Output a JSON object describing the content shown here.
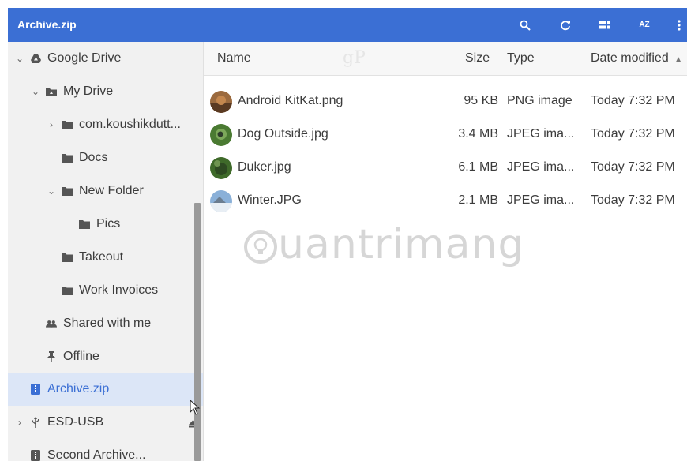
{
  "window": {
    "title": "Archive.zip"
  },
  "toolbar": {
    "icons": [
      "search-icon",
      "refresh-icon",
      "grid-view-icon",
      "sort-az-icon",
      "more-vert-icon"
    ],
    "sort_label": "AZ"
  },
  "sidebar": {
    "items": [
      {
        "label": "Google Drive",
        "icon": "drive-icon",
        "chevron": "down"
      },
      {
        "label": "My Drive",
        "icon": "my-drive-icon",
        "chevron": "down"
      },
      {
        "label": "com.koushikdutt...",
        "icon": "folder-icon",
        "chevron": "right"
      },
      {
        "label": "Docs",
        "icon": "folder-icon"
      },
      {
        "label": "New Folder",
        "icon": "folder-icon",
        "chevron": "down"
      },
      {
        "label": "Pics",
        "icon": "folder-icon"
      },
      {
        "label": "Takeout",
        "icon": "folder-icon"
      },
      {
        "label": "Work Invoices",
        "icon": "folder-icon"
      },
      {
        "label": "Shared with me",
        "icon": "people-icon"
      },
      {
        "label": "Offline",
        "icon": "pin-icon"
      },
      {
        "label": "Archive.zip",
        "icon": "zip-icon",
        "selected": true,
        "eject": true
      },
      {
        "label": "ESD-USB",
        "icon": "usb-icon",
        "chevron": "right",
        "eject": true
      },
      {
        "label": "Second Archive...",
        "icon": "zip-icon",
        "eject": true
      }
    ]
  },
  "table": {
    "columns": {
      "name": "Name",
      "size": "Size",
      "type": "Type",
      "date": "Date modified",
      "sort_indicator": "▲"
    },
    "rows": [
      {
        "name": "Android KitKat.png",
        "size": "95 KB",
        "type": "PNG image",
        "date": "Today 7:32 PM"
      },
      {
        "name": "Dog Outside.jpg",
        "size": "3.4 MB",
        "type": "JPEG ima...",
        "date": "Today 7:32 PM"
      },
      {
        "name": "Duker.jpg",
        "size": "6.1 MB",
        "type": "JPEG ima...",
        "date": "Today 7:32 PM"
      },
      {
        "name": "Winter.JPG",
        "size": "2.1 MB",
        "type": "JPEG ima...",
        "date": "Today 7:32 PM"
      }
    ]
  },
  "watermark": {
    "text": "uantrimang",
    "gp": "gP"
  },
  "colors": {
    "accent": "#3b6fd4",
    "selected_bg": "#dce6f7",
    "sidebar_bg": "#f1f1f1"
  }
}
